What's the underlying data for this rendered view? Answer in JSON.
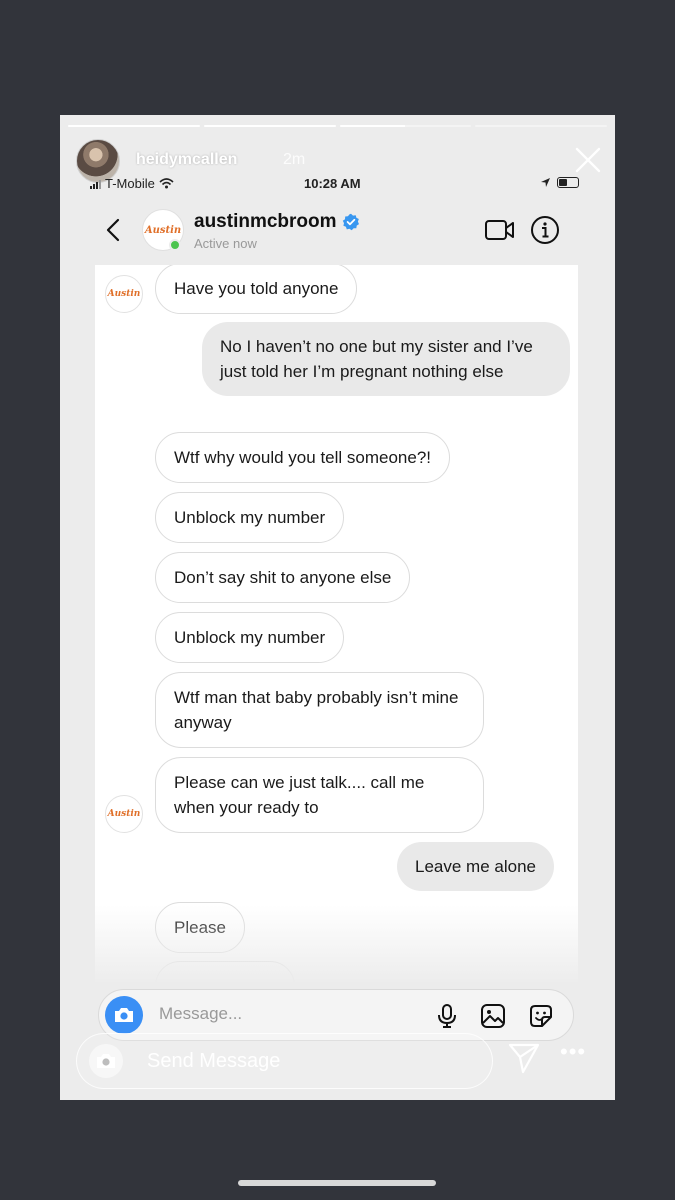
{
  "story": {
    "username": "heidymcallen",
    "time_ago": "2m",
    "progress": [
      1.0,
      1.0,
      0.5,
      0.0
    ]
  },
  "status_bar": {
    "carrier": "T-Mobile",
    "time": "10:28 AM"
  },
  "dm_header": {
    "avatar_text": "Austin",
    "name": "austinmcbroom",
    "status": "Active now"
  },
  "messages": [
    {
      "side": "in",
      "text": "Have you told anyone"
    },
    {
      "side": "out",
      "text": "No I haven’t no one but my sister and I’ve just told her I’m pregnant nothing else"
    },
    {
      "side": "in",
      "text": "Wtf why would you tell someone?!"
    },
    {
      "side": "in",
      "text": "Unblock my number"
    },
    {
      "side": "in",
      "text": "Don’t say shit to anyone else"
    },
    {
      "side": "in",
      "text": "Unblock my number"
    },
    {
      "side": "in",
      "text": "Wtf man that baby probably isn’t mine anyway"
    },
    {
      "side": "in",
      "text": "Please can we just talk.... call me when your ready to"
    },
    {
      "side": "out",
      "text": "Leave me alone"
    },
    {
      "side": "in",
      "text": "Please"
    }
  ],
  "composer": {
    "placeholder": "Message..."
  },
  "reply": {
    "placeholder": "Send Message"
  },
  "icons": [
    "close-icon",
    "wifi-icon",
    "location-arrow-icon",
    "battery-icon",
    "back-chevron-icon",
    "verified-badge-icon",
    "video-call-icon",
    "info-icon",
    "camera-icon",
    "microphone-icon",
    "gallery-icon",
    "sticker-icon",
    "send-icon",
    "more-icon"
  ],
  "colors": {
    "verified": "#3897f0",
    "online": "#4cc44f",
    "camera_button": "#3a8ff5"
  }
}
